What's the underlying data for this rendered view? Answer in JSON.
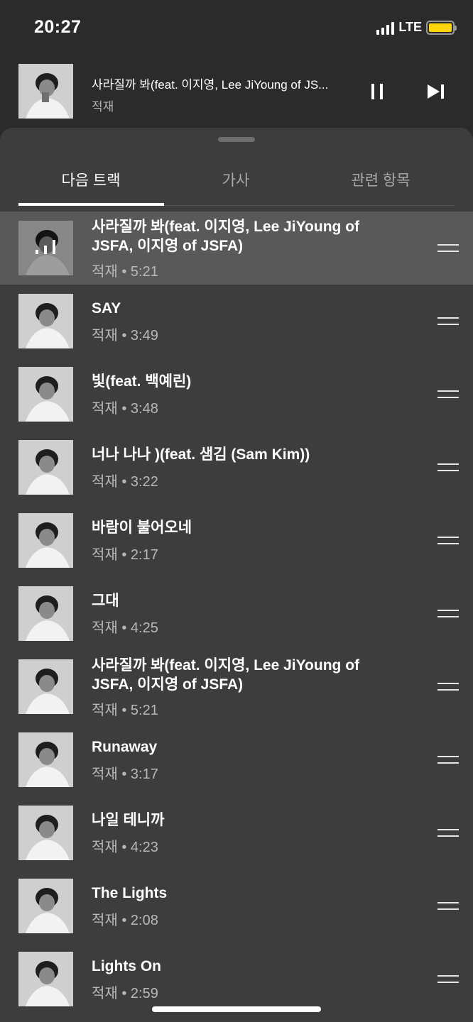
{
  "status": {
    "time": "20:27",
    "network": "LTE"
  },
  "mini_player": {
    "title": "사라질까 봐(feat. 이지영, Lee JiYoung of JS...",
    "artist": "적재"
  },
  "tabs": [
    {
      "label": "다음 트랙",
      "active": true
    },
    {
      "label": "가사",
      "active": false
    },
    {
      "label": "관련 항목",
      "active": false
    }
  ],
  "queue": [
    {
      "title": "사라질까 봐(feat. 이지영, Lee JiYoung of JSFA, 이지영 of JSFA)",
      "meta": "적재 • 5:21",
      "playing": true
    },
    {
      "title": "SAY",
      "meta": "적재 • 3:49"
    },
    {
      "title": "빛(feat. 백예린)",
      "meta": "적재 • 3:48"
    },
    {
      "title": "너나 나나 )(feat. 샘김 (Sam Kim))",
      "meta": "적재 • 3:22"
    },
    {
      "title": "바람이 불어오네",
      "meta": "적재 • 2:17"
    },
    {
      "title": "그대",
      "meta": "적재 • 4:25"
    },
    {
      "title": "사라질까 봐(feat. 이지영, Lee JiYoung of JSFA, 이지영 of JSFA)",
      "meta": "적재 • 5:21"
    },
    {
      "title": "Runaway",
      "meta": "적재 • 3:17"
    },
    {
      "title": "나일 테니까",
      "meta": "적재 • 4:23"
    },
    {
      "title": "The Lights",
      "meta": "적재 • 2:08"
    },
    {
      "title": "Lights On",
      "meta": "적재 • 2:59"
    }
  ],
  "colors": {
    "background": "#2b2b2b",
    "sheet": "#3d3d3d",
    "current_row": "#595959",
    "battery": "#ffd60a"
  }
}
